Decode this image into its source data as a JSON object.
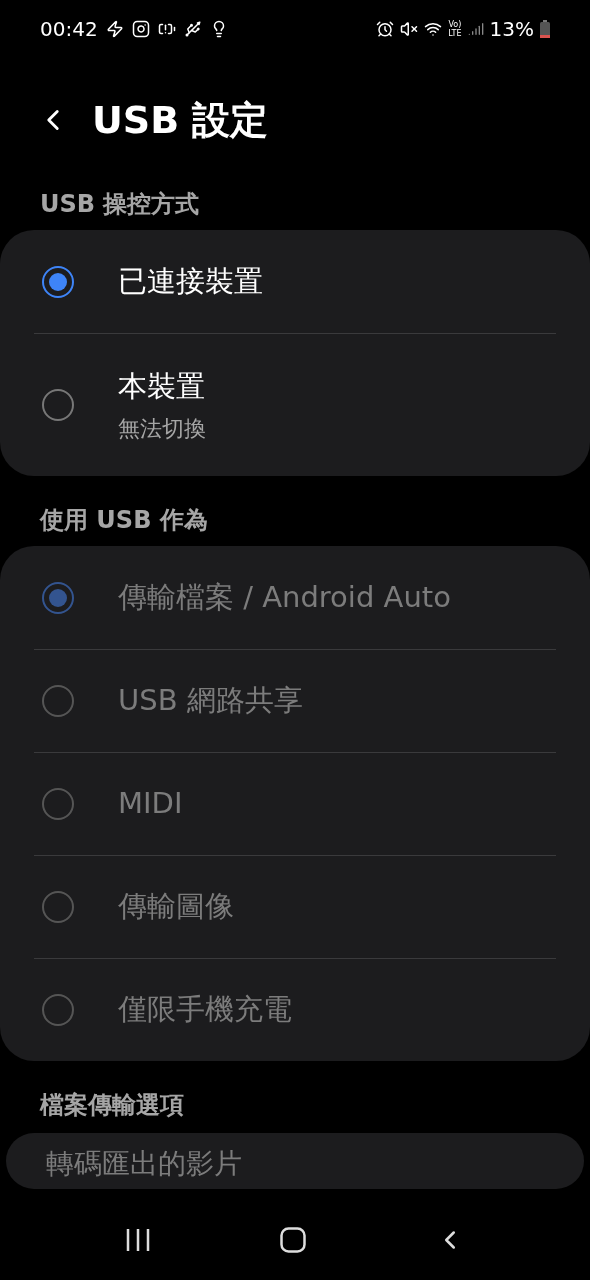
{
  "status_bar": {
    "time": "00:42",
    "network": "Vo)\nLTE",
    "battery": "13%"
  },
  "header": {
    "title": "USB 設定"
  },
  "sections": [
    {
      "title": "USB 操控方式",
      "items": [
        {
          "label": "已連接裝置",
          "selected": true,
          "disabled": false
        },
        {
          "label": "本裝置",
          "subtitle": "無法切換",
          "selected": false,
          "disabled": false
        }
      ]
    },
    {
      "title": "使用 USB 作為",
      "items": [
        {
          "label": "傳輸檔案 / Android Auto",
          "selected": true,
          "disabled": true
        },
        {
          "label": "USB 網路共享",
          "selected": false,
          "disabled": true
        },
        {
          "label": "MIDI",
          "selected": false,
          "disabled": true
        },
        {
          "label": "傳輸圖像",
          "selected": false,
          "disabled": true
        },
        {
          "label": "僅限手機充電",
          "selected": false,
          "disabled": true
        }
      ]
    },
    {
      "title": "檔案傳輸選項",
      "items": [
        {
          "label": "轉碼匯出的影片",
          "kind": "plain"
        }
      ]
    }
  ]
}
